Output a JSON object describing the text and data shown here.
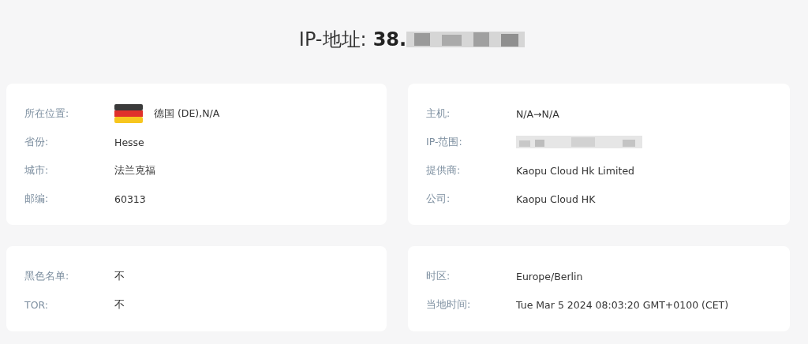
{
  "title": {
    "label": "IP-地址:",
    "value": "38.",
    "redacted": true
  },
  "cards": [
    {
      "rows": [
        {
          "kind": "flag",
          "label": "所在位置:",
          "value": "德国 (DE),N/A"
        },
        {
          "kind": "text",
          "label": "省份:",
          "value": "Hesse"
        },
        {
          "kind": "text",
          "label": "城市:",
          "value": "法兰克福"
        },
        {
          "kind": "text",
          "label": "邮编:",
          "value": "60313"
        }
      ]
    },
    {
      "rows": [
        {
          "kind": "text",
          "label": "主机:",
          "value": "N/A→N/A"
        },
        {
          "kind": "redacted",
          "label": "IP-范围:"
        },
        {
          "kind": "text",
          "label": "提供商:",
          "value": "Kaopu Cloud Hk Limited"
        },
        {
          "kind": "text",
          "label": "公司:",
          "value": "Kaopu Cloud HK"
        }
      ]
    },
    {
      "rows": [
        {
          "kind": "text",
          "label": "黑色名单:",
          "value": "不"
        },
        {
          "kind": "text",
          "label": "TOR:",
          "value": "不"
        }
      ]
    },
    {
      "rows": [
        {
          "kind": "text",
          "label": "时区:",
          "value": "Europe/Berlin"
        },
        {
          "kind": "text",
          "label": "当地时间:",
          "value": "Tue Mar 5 2024 08:03:20 GMT+0100 (CET)"
        }
      ]
    }
  ]
}
